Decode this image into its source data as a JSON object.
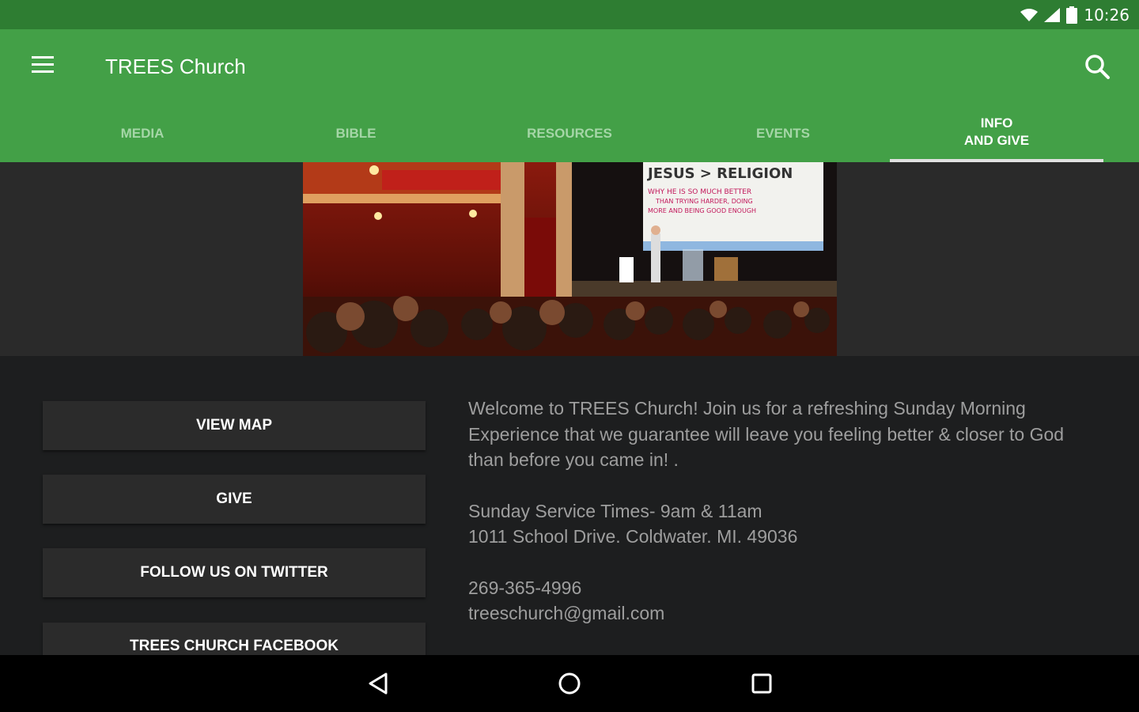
{
  "status_bar": {
    "time": "10:26"
  },
  "app_bar": {
    "title": "TREES Church"
  },
  "tabs": [
    {
      "label": "MEDIA",
      "active": false
    },
    {
      "label": "BIBLE",
      "active": false
    },
    {
      "label": "RESOURCES",
      "active": false
    },
    {
      "label": "EVENTS",
      "active": false
    },
    {
      "label": "INFO\nAND GIVE",
      "active": true
    }
  ],
  "hero": {
    "screen_title": "JESUS > RELIGION",
    "screen_lines": [
      "WHY HE IS SO MUCH BETTER",
      "THAN TRYING HARDER, DOING",
      "MORE AND BEING GOOD ENOUGH"
    ]
  },
  "buttons": {
    "view_map": "VIEW MAP",
    "give": "GIVE",
    "twitter": "FOLLOW US ON TWITTER",
    "facebook": "TREES CHURCH FACEBOOK"
  },
  "info": {
    "welcome": "Welcome to TREES Church!  Join us for a refreshing Sunday Morning Experience that we guarantee will leave you feeling better & closer to God than before you came in! .",
    "service_times": "Sunday Service Times- 9am & 11am",
    "address": "1011 School Drive. Coldwater. MI. 49036",
    "phone": "269-365-4996",
    "email": "treeschurch@gmail.com"
  },
  "colors": {
    "status_bar": "#2e7d32",
    "app_bar": "#43a047",
    "inactive_tab": "#a5d6a7"
  }
}
